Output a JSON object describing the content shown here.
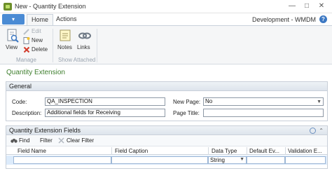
{
  "window": {
    "title": "New - Quantity Extension"
  },
  "ribbon_tabs": [
    "Home",
    "Actions"
  ],
  "company": "Development - WMDM",
  "ribbon": {
    "view": "View",
    "edit": "Edit",
    "new": "New",
    "delete": "Delete",
    "notes": "Notes",
    "links": "Links",
    "group_manage": "Manage",
    "group_show_attached": "Show Attached"
  },
  "page_title": "Quantity Extension",
  "general": {
    "header": "General",
    "code_label": "Code:",
    "code_value": "QA_INSPECTION",
    "description_label": "Description:",
    "description_value": "Additional fields for Receiving",
    "new_page_label": "New Page:",
    "new_page_value": "No",
    "page_title_label": "Page Title:",
    "page_title_value": ""
  },
  "lines": {
    "header": "Quantity Extension Fields",
    "find": "Find",
    "filter": "Filter",
    "clear_filter": "Clear Filter",
    "columns": [
      "Field Name",
      "Field Caption",
      "Data Type",
      "Default Ev...",
      "Validation E..."
    ],
    "row": {
      "data_type": "String"
    }
  }
}
